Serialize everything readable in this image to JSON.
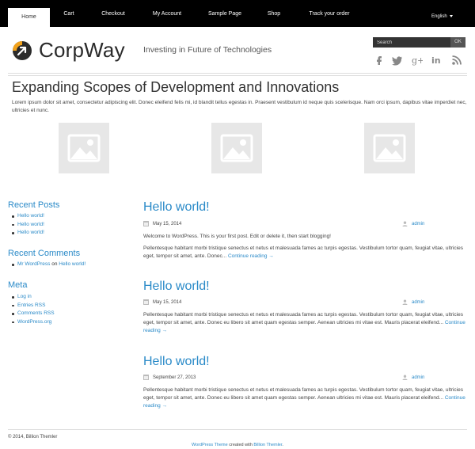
{
  "nav": {
    "items": [
      {
        "label": "Home",
        "active": true
      },
      {
        "label": "Cart"
      },
      {
        "label": "Checkout"
      },
      {
        "label": "My Account"
      },
      {
        "label": "Sample Page"
      },
      {
        "label": "Shop"
      },
      {
        "label": "Track your order"
      }
    ],
    "language": "English"
  },
  "header": {
    "site_title": "CorpWay",
    "tagline": "Investing in Future of Technologies",
    "search_placeholder": "Search",
    "search_button": "OK",
    "social_icons": [
      "facebook-icon",
      "twitter-icon",
      "google-plus-icon",
      "linkedin-icon",
      "rss-icon"
    ]
  },
  "hero": {
    "title": "Expanding Scopes of Development and Innovations",
    "text": "Lorem ipsum dolor sit amet, consectetur adipiscing elit. Donec eleifend felis mi, id blandit tellus egestas in. Praesent vestibulum id neque quis scelerisque. Nam orci ipsum, dapibus vitae imperdiet nec, ultricies et nunc."
  },
  "sidebar": {
    "recent_posts": {
      "title": "Recent Posts",
      "items": [
        "Hello world!",
        "Hello world!",
        "Hello world!"
      ]
    },
    "recent_comments": {
      "title": "Recent Comments",
      "author": "Mr WordPress",
      "on": "on",
      "post": "Hello world!"
    },
    "meta": {
      "title": "Meta",
      "items": [
        "Log in",
        "Entries RSS",
        "Comments RSS",
        "WordPress.org"
      ]
    }
  },
  "posts": [
    {
      "title": "Hello world!",
      "date": "May 15, 2014",
      "author": "admin",
      "text": "Welcome to WordPress. This is your first post. Edit or delete it, then start blogging!",
      "text2": "Pellentesque habitant morbi tristique senectus et netus et malesuada fames ac turpis egestas. Vestibulum tortor quam, feugiat vitae, ultricies eget, tempor sit amet, ante. Donec...",
      "read_more": "Continue reading →"
    },
    {
      "title": "Hello world!",
      "date": "May 15, 2014",
      "author": "admin",
      "text": "Pellentesque habitant morbi tristique senectus et netus et malesuada fames ac turpis egestas. Vestibulum tortor quam, feugiat vitae, ultricies eget, tempor sit amet, ante. Donec eu libero sit amet quam egestas semper. Aenean ultricies mi vitae est. Mauris placerat eleifend...",
      "read_more": "Continue reading →"
    },
    {
      "title": "Hello world!",
      "date": "September 27, 2013",
      "author": "admin",
      "text": "Pellentesque habitant morbi tristique senectus et netus et malesuada fames ac turpis egestas. Vestibulum tortor quam, feugiat vitae, ultricies eget, tempor sit amet, ante. Donec eu libero sit amet quam egestas semper. Aenean ultricies mi vitae est. Mauris placerat eleifend...",
      "read_more": "Continue reading →"
    }
  ],
  "footer": {
    "copyright": "© 2014, Billion Themler",
    "credit_link1": "WordPress Theme",
    "credit_middle": " created with ",
    "credit_link2": "Billion Themler",
    "credit_end": "."
  },
  "colors": {
    "accent": "#2a8ac8",
    "nav_bg": "#000000",
    "logo_orange": "#f2a21b"
  }
}
